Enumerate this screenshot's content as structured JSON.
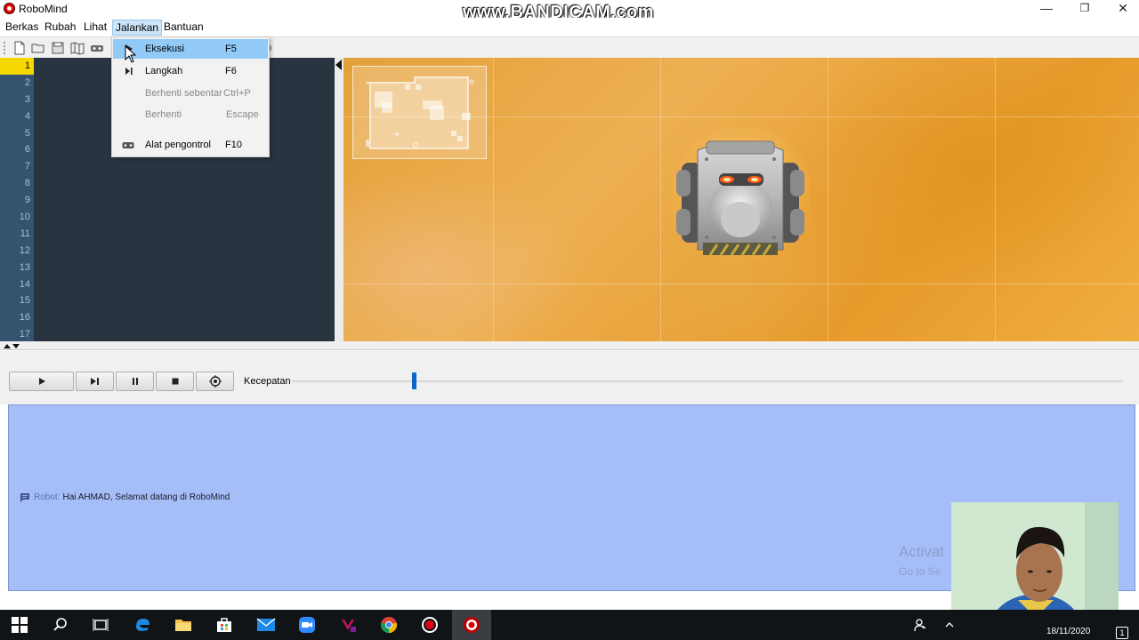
{
  "window": {
    "title": "RoboMind",
    "watermark": "www.BANDICAM.com",
    "controls": {
      "minimize": "—",
      "restore": "❐",
      "close": "✕"
    }
  },
  "menubar": [
    {
      "label": "Berkas"
    },
    {
      "label": "Rubah"
    },
    {
      "label": "Lihat"
    },
    {
      "label": "Jalankan"
    },
    {
      "label": "Bantuan"
    }
  ],
  "toolbar": {
    "icons": [
      "new-file-icon",
      "open-folder-icon",
      "save-icon",
      "map-icon",
      "remote-icon"
    ]
  },
  "run_menu": {
    "items": [
      {
        "label": "Eksekusi",
        "shortcut": "F5",
        "icon": "play-icon",
        "highlighted": true,
        "enabled": true
      },
      {
        "label": "Langkah",
        "shortcut": "F6",
        "icon": "step-icon",
        "highlighted": false,
        "enabled": true
      },
      {
        "label": "Berhenti sebentar",
        "shortcut": "Ctrl+P",
        "icon": "",
        "highlighted": false,
        "enabled": false
      },
      {
        "label": "Berhenti",
        "shortcut": "Escape",
        "icon": "",
        "highlighted": false,
        "enabled": false
      },
      {
        "label": "Alat pengontrol",
        "shortcut": "F10",
        "icon": "gamepad-icon",
        "highlighted": false,
        "enabled": true
      }
    ]
  },
  "editor": {
    "line_numbers": [
      "1",
      "2",
      "3",
      "4",
      "5",
      "6",
      "7",
      "8",
      "9",
      "10",
      "11",
      "12",
      "13",
      "14",
      "15",
      "16",
      "17"
    ],
    "current_line": "1",
    "code": ""
  },
  "controls": {
    "speed_label": "Kecepatan",
    "speed_value": 0.15
  },
  "messages": [
    {
      "from": "Robot:",
      "text": "Hai AHMAD, Selamat datang di RoboMind"
    }
  ],
  "overlay": {
    "activate_title": "Activat",
    "activate_sub": "Go to Se"
  },
  "taskbar": {
    "date": "18/11/2020",
    "notification_count": "1"
  },
  "colors": {
    "editor_bg": "#283541",
    "gutter_bg": "#34536f",
    "current_line": "#f5d800",
    "world_orange": "#e9a23a",
    "message_panel": "#a6bef7",
    "menu_highlight": "#91c9f7",
    "slider_thumb": "#0b64c8"
  }
}
